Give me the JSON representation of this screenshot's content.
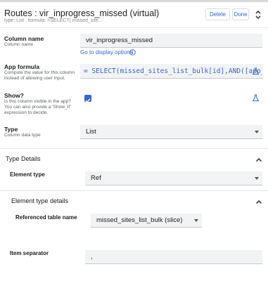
{
  "header": {
    "title": "Routes : vir_inprogress_missed (virtual)",
    "type_label": "type:",
    "type_value": "List",
    "formula_label": "formula:",
    "formula_value": "=SELECT( missed_site...",
    "delete_label": "Delete",
    "done_label": "Done"
  },
  "column_name": {
    "label": "Column name",
    "help": "Column name",
    "value": "vir_inprogress_missed",
    "display_options_link": "Go to display options"
  },
  "app_formula": {
    "label": "App formula",
    "help": "Compute the value for this column instead of allowing user input.",
    "value": "= SELECT(missed_sites_list_bulk[id],AND([app_route"
  },
  "show": {
    "label": "Show?",
    "help": "Is this column visible in the app? You can also provide a 'Show_If' expression to decide.",
    "checked": true
  },
  "type": {
    "label": "Type",
    "help": "Column data type",
    "value": "List"
  },
  "type_details": {
    "title": "Type Details",
    "element_type_label": "Element type",
    "element_type_value": "Ref"
  },
  "element_type_details": {
    "title": "Element type details",
    "referenced_table_label": "Referenced table name",
    "referenced_table_value": "missed_sites_list_bulk (slice)",
    "item_separator_label": "Item separator",
    "item_separator_value": ","
  },
  "colors": {
    "accent": "#3367d6",
    "formula_text": "#3c64c6",
    "field_bg": "#f1f3f4"
  }
}
